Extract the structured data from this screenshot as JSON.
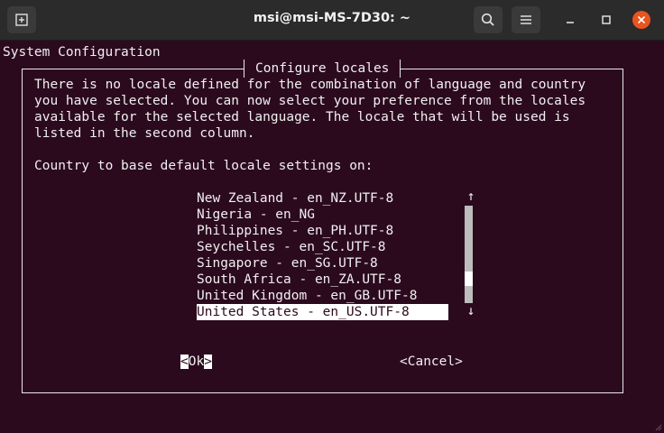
{
  "window": {
    "title": "msi@msi-MS-7D30: ~"
  },
  "terminal": {
    "header": "System Configuration",
    "dialog_title": "Configure locales",
    "description": [
      "There is no locale defined for the combination of language and country",
      "you have selected. You can now select your preference from the locales",
      "available for the selected language. The locale that will be used is",
      "listed in the second column."
    ],
    "prompt": "Country to base default locale settings on:",
    "locales": [
      "New Zealand - en_NZ.UTF-8",
      "Nigeria - en_NG",
      "Philippines - en_PH.UTF-8",
      "Seychelles - en_SC.UTF-8",
      "Singapore - en_SG.UTF-8",
      "South Africa - en_ZA.UTF-8",
      "United Kingdom - en_GB.UTF-8",
      "United States - en_US.UTF-8"
    ],
    "selected_locale": "United States - en_US.UTF-8",
    "scroll_up": "↑",
    "scroll_down": "↓",
    "ok": {
      "open": "<",
      "label": "Ok",
      "close": ">"
    },
    "cancel_label": "<Cancel>"
  },
  "colors": {
    "terminal_bg": "#2c0a1e",
    "titlebar_bg": "#2b2b2b",
    "close_button": "#e95420",
    "text": "#f0f0f0"
  },
  "icons": {
    "new_tab": "new-tab-icon",
    "search": "search-icon",
    "menu": "hamburger-menu-icon",
    "minimize": "minimize-icon",
    "maximize": "maximize-icon",
    "close": "close-icon"
  }
}
